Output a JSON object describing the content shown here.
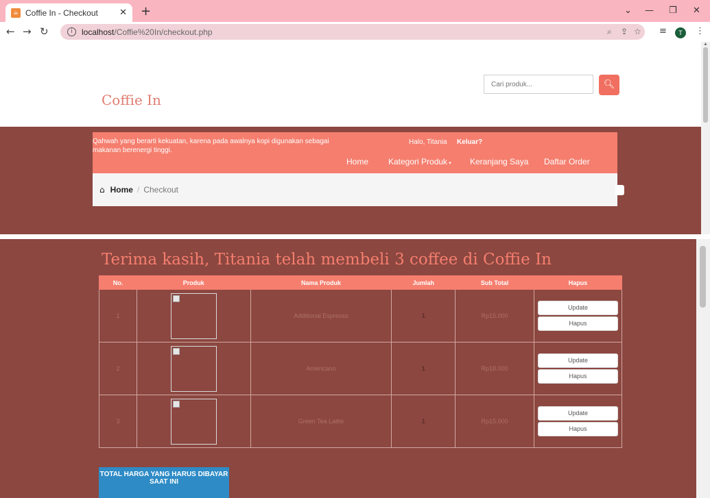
{
  "browser": {
    "tab_title": "Coffie In - Checkout",
    "url_host": "localhost",
    "url_path": "/Coffie%20In/checkout.php",
    "profile_initial": "T"
  },
  "header": {
    "brand": "Coffie In",
    "search_placeholder": "Cari produk..."
  },
  "navbar": {
    "tagline": "Qahwah yang berarti kekuatan, karena pada awalnya kopi digunakan sebagai makanan berenergi tinggi.",
    "greeting": "Halo, Titania",
    "logout": "Keluar?",
    "links": {
      "home": "Home",
      "categories": "Kategori Produk",
      "cart": "Keranjang Saya",
      "orders": "Daftar Order"
    }
  },
  "breadcrumb": {
    "home": "Home",
    "separator": "/",
    "current": "Checkout"
  },
  "main": {
    "thanks_message": "Terima kasih, Titania telah membeli 3 coffee di Coffie In",
    "table": {
      "headers": [
        "No.",
        "Produk",
        "Nama Produk",
        "Jumlah",
        "Sub Total",
        "Hapus"
      ],
      "rows": [
        {
          "no": "1",
          "name": "Additional Espresso",
          "qty": "1",
          "subtotal": "Rp15.000",
          "update": "Update",
          "delete": "Hapus"
        },
        {
          "no": "2",
          "name": "Americano",
          "qty": "1",
          "subtotal": "Rp18.000",
          "update": "Update",
          "delete": "Hapus"
        },
        {
          "no": "3",
          "name": "Green Tea Lattie",
          "qty": "1",
          "subtotal": "Rp15.000",
          "update": "Update",
          "delete": "Hapus"
        }
      ]
    },
    "total_label": "TOTAL HARGA YANG HARUS DIBAYAR SAAT INI"
  },
  "colors": {
    "navbar": "#f57e6e",
    "band": "#8b4740",
    "total_button": "#2e8bc6"
  }
}
